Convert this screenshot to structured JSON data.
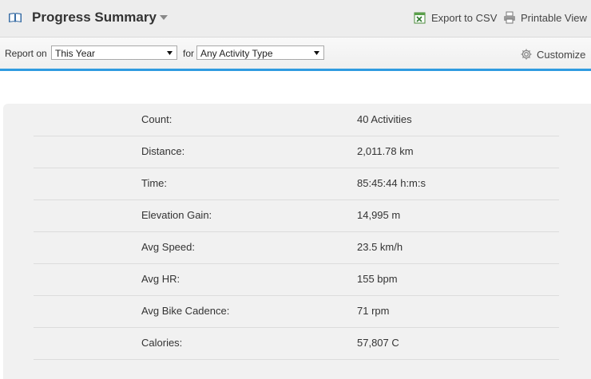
{
  "header": {
    "title": "Progress Summary",
    "export_label": "Export to CSV",
    "printable_label": "Printable View"
  },
  "filters": {
    "report_on_label": "Report on",
    "period_value": "This Year",
    "for_label": "for",
    "activity_value": "Any Activity Type",
    "customize_label": "Customize"
  },
  "summary": [
    {
      "label": "Count:",
      "value": "40 Activities"
    },
    {
      "label": "Distance:",
      "value": "2,011.78 km"
    },
    {
      "label": "Time:",
      "value": "85:45:44 h:m:s"
    },
    {
      "label": "Elevation Gain:",
      "value": "14,995 m"
    },
    {
      "label": "Avg Speed:",
      "value": "23.5 km/h"
    },
    {
      "label": "Avg HR:",
      "value": "155 bpm"
    },
    {
      "label": "Avg Bike Cadence:",
      "value": "71 rpm"
    },
    {
      "label": "Calories:",
      "value": "57,807 C"
    }
  ],
  "colors": {
    "accent_blue": "#2f9be0",
    "header_bg": "#ededed",
    "panel_bg": "#f1f1f1"
  },
  "icons": {
    "title": "book-icon",
    "export": "spreadsheet-icon",
    "printable": "printer-icon",
    "customize": "gear-icon"
  }
}
